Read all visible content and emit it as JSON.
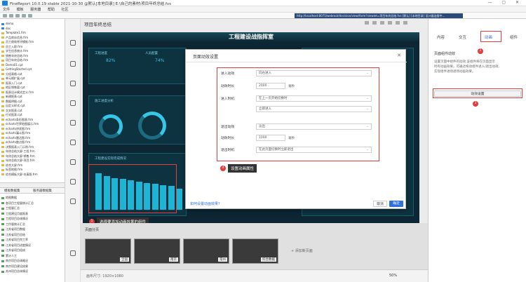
{
  "titlebar": {
    "title": "FineReport 10.0.19 stable 2021-10-30 @默认[本地目录]    E:\\自己的素材\\项目年终总结.fvs"
  },
  "menu": [
    "文件",
    "模板",
    "服务器",
    "帮助",
    "社区"
  ],
  "toolbar": {
    "url": "http://localhost:8075/webroot/decision/view/form?viewlet=项目年终总结.fvs  [默认]   [本地目录]   设计器连接中..."
  },
  "tree": {
    "items": [
      {
        "label": "demo",
        "kind": "f"
      },
      {
        "label": "doc",
        "kind": "f"
      },
      {
        "label": "Template1.frm",
        "kind": "d"
      },
      {
        "label": "产品库存信息.frm",
        "kind": "d"
      },
      {
        "label": "员工绩效考评模板.frm",
        "kind": "d"
      },
      {
        "label": "员工入职.frm",
        "kind": "d"
      },
      {
        "label": "学生信息统计.frm",
        "kind": "d"
      },
      {
        "label": "销售年终总结.frm",
        "kind": "d"
      },
      {
        "label": "项目年终总结.frm",
        "kind": "d"
      },
      {
        "label": "Demo01.cpt",
        "kind": "d"
      },
      {
        "label": "GettingStarted.cpt",
        "kind": "d"
      },
      {
        "label": "分组表格.cpt",
        "kind": "d"
      },
      {
        "label": "单元格扩展.cpt",
        "kind": "d"
      },
      {
        "label": "报表入门.cpt",
        "kind": "d"
      },
      {
        "label": "地区销售量.cpt",
        "kind": "d"
      },
      {
        "label": "报表设计模式定义.frm",
        "kind": "d"
      },
      {
        "label": "新建报表.cpt",
        "kind": "d"
      },
      {
        "label": "数据明细.cpt",
        "kind": "d"
      },
      {
        "label": "自定义样式.cpt",
        "kind": "d"
      },
      {
        "label": "交叉报表.cpt",
        "kind": "d"
      },
      {
        "label": "行式报表.cpt",
        "kind": "d"
      },
      {
        "label": "echarts条形图表.frm",
        "kind": "d"
      },
      {
        "label": "echarts世界地图展示.frm",
        "kind": "d"
      },
      {
        "label": "echarts饼状图.frm",
        "kind": "d"
      },
      {
        "label": "echarts漏斗图.frm",
        "kind": "d"
      },
      {
        "label": "echarts雷达图.frm",
        "kind": "d"
      },
      {
        "label": "echarts散点图.frm",
        "kind": "d"
      },
      {
        "label": "决策报表入门示例.frm",
        "kind": "d"
      },
      {
        "label": "年终总结大屏-工程.frm",
        "kind": "d"
      },
      {
        "label": "年终总结大屏-销售.frm",
        "kind": "d"
      },
      {
        "label": "年终总结大屏-项目.frm",
        "kind": "d"
      },
      {
        "label": "综合大屏.frm",
        "kind": "d"
      },
      {
        "label": "标签地图.frm",
        "kind": "d"
      },
      {
        "label": "综合模板大屏-仿真版.frm",
        "kind": "d"
      }
    ],
    "bottom_tabs": [
      "模板数据集",
      "服务器数据集"
    ],
    "bottom_items": [
      {
        "label": "地图数据",
        "kind": "g"
      },
      {
        "label": "各项目工程量统计汇总",
        "kind": "g"
      },
      {
        "label": "工程量汇总",
        "kind": "g"
      },
      {
        "label": "工程建设月度报表",
        "kind": "g"
      },
      {
        "label": "工程项目总体情况",
        "kind": "g"
      },
      {
        "label": "工作量统计汇总",
        "kind": "g"
      },
      {
        "label": "江苏省项目数据",
        "kind": "g"
      },
      {
        "label": "江苏省项目总结",
        "kind": "g"
      },
      {
        "label": "江苏省项目完工率",
        "kind": "g"
      },
      {
        "label": "江苏省项目进度情况",
        "kind": "g"
      },
      {
        "label": "江苏省项目组成",
        "kind": "g"
      },
      {
        "label": "累计人工",
        "kind": "g"
      },
      {
        "label": "南京项目总体概况",
        "kind": "g"
      },
      {
        "label": "南京项目建设成果",
        "kind": "g"
      },
      {
        "label": "苏州项目总体情况",
        "kind": "g"
      }
    ]
  },
  "canvas": {
    "name": "项目年终总结",
    "dashboard_title": "工程建设战指挥室",
    "kpi1_label": "工程进度",
    "kpi1_value": "82%",
    "kpi2_label": "人员配置",
    "kpi2_value": "74%",
    "section2_label": "施工进度分析",
    "chart_label": "工程建设实际完成情况",
    "callout1": "选择要添加动画效果的组件",
    "callout2": "设置动画属性"
  },
  "modal": {
    "title": "页面动效设置",
    "enter_effect_label": "进入动效",
    "enter_effect_value": "向右进入",
    "enter_duration_label": "动效时长",
    "enter_duration_value": "2000",
    "unit": "毫秒",
    "enter_timing_label": "进入时机",
    "enter_timing_value": "在上一页开始切换时",
    "enter_timing2_value": "立即进入",
    "exit_effect_label": "退出动效",
    "exit_effect_value": "淡出",
    "exit_duration_label": "动效时长",
    "exit_duration_value": "1000",
    "exit_timing_label": "退出时机",
    "exit_timing_value": "在此页面切换时立即退出",
    "help_link": "如何设置动画效果?",
    "cancel": "取消",
    "ok": "确定"
  },
  "right": {
    "tabs": [
      "内容",
      "交互",
      "动画",
      "组件"
    ],
    "section": "页面组件动效",
    "desc1": "设置页面中组件的动效,该组件将在页面显示",
    "desc2": "时有动画效果。可通过拖动组件进入/退出动效,",
    "desc3": "实现组件进场退场动画效果。",
    "button": "动效设置"
  },
  "badges": [
    "1",
    "2",
    "3",
    "4"
  ],
  "thumbs": {
    "caption": "页面分页",
    "items": [
      "全国",
      "南京",
      "常州",
      "综合数据"
    ],
    "add": "+ 添加新页面"
  },
  "status": {
    "size": "画布尺寸: 1920×1080",
    "zoom": "50%"
  }
}
